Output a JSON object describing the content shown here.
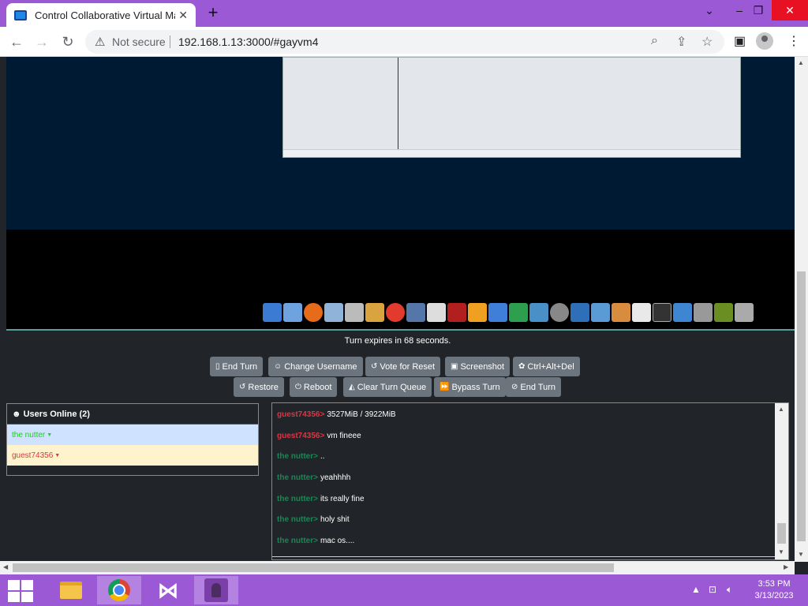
{
  "browser": {
    "tab_title": "Control Collaborative Virtual Mac",
    "not_secure": "Not secure",
    "url": "192.168.1.13:3000/#gayvm4"
  },
  "vm": {
    "turn_text": "Turn expires in 68 seconds.",
    "buttons_row1": [
      "End Turn",
      "Change Username",
      "Vote for Reset",
      "Screenshot",
      "Ctrl+Alt+Del"
    ],
    "buttons_row2": [
      "Restore",
      "Reboot",
      "Clear Turn Queue",
      "Bypass Turn",
      "End Turn"
    ]
  },
  "users": {
    "header": "Users Online (2)",
    "list": [
      {
        "name": "the nutter",
        "color": "#22cc22",
        "bg": "#cfe2ff"
      },
      {
        "name": "guest74356",
        "color": "#dc3545",
        "bg": "#fff3cd"
      }
    ]
  },
  "chat": {
    "messages": [
      {
        "user": "guest74356>",
        "text": "3527MiB / 3922MiB",
        "color": "#dc3545"
      },
      {
        "user": "guest74356>",
        "text": "vm fineee",
        "color": "#dc3545"
      },
      {
        "user": "the nutter>",
        "text": "..",
        "color": "#198754"
      },
      {
        "user": "the nutter>",
        "text": "yeahhhh",
        "color": "#198754"
      },
      {
        "user": "the nutter>",
        "text": "its really fine",
        "color": "#198754"
      },
      {
        "user": "the nutter>",
        "text": "holy shit",
        "color": "#198754"
      },
      {
        "user": "the nutter>",
        "text": "mac os....",
        "color": "#198754"
      }
    ]
  },
  "taskbar": {
    "time": "3:53 PM",
    "date": "3/13/2023"
  }
}
